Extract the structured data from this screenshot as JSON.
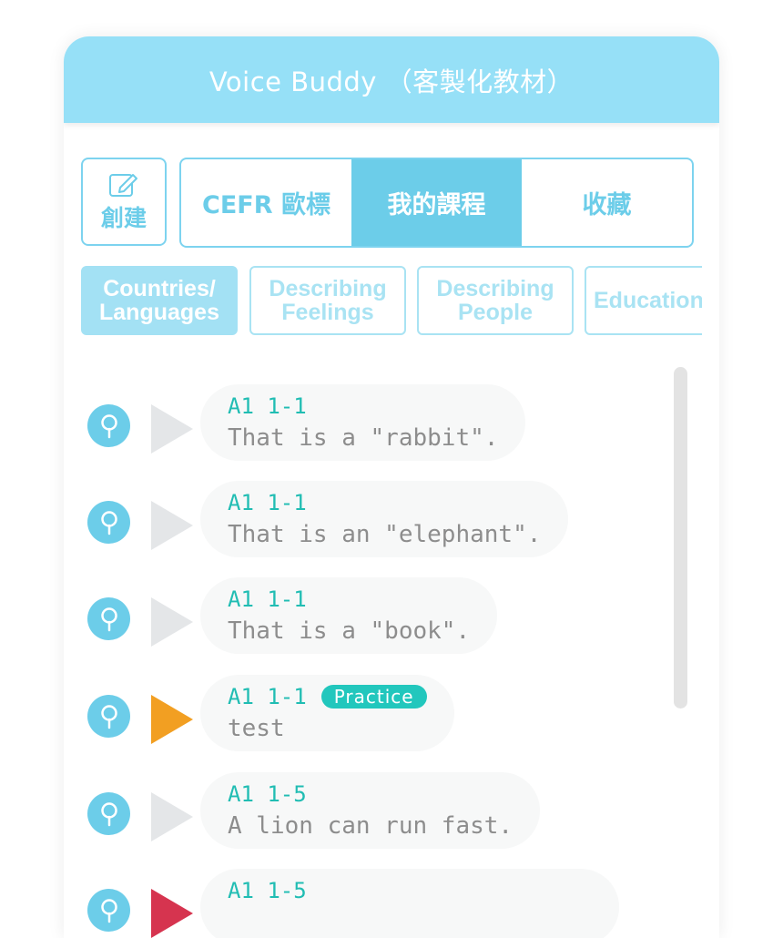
{
  "header": {
    "title": "Voice Buddy （客製化教材）"
  },
  "toolbar": {
    "create_label": "創建",
    "tabs": [
      {
        "label": "CEFR 歐標",
        "active": false
      },
      {
        "label": "我的課程",
        "active": true
      },
      {
        "label": "收藏",
        "active": false
      }
    ]
  },
  "categories": [
    {
      "label": "Countries/ Languages",
      "active": true
    },
    {
      "label": "Describing Feelings",
      "active": false
    },
    {
      "label": "Describing People",
      "active": false
    },
    {
      "label": "Education",
      "active": false
    }
  ],
  "sentences": [
    {
      "level": "A1 1-1",
      "text": "That is a \"rabbit\".",
      "badge": "",
      "play_color": "#e4e6e8"
    },
    {
      "level": "A1 1-1",
      "text": "That is an \"elephant\".",
      "badge": "",
      "play_color": "#e4e6e8"
    },
    {
      "level": "A1 1-1",
      "text": "That is a \"book\".",
      "badge": "",
      "play_color": "#e4e6e8"
    },
    {
      "level": "A1 1-1",
      "text": "test",
      "badge": "Practice",
      "play_color": "#f29f22"
    },
    {
      "level": "A1 1-5",
      "text": "A lion can run fast.",
      "badge": "",
      "play_color": "#e4e6e8"
    },
    {
      "level": "A1 1-5",
      "text": "",
      "badge": "",
      "play_color": "#d6344f"
    }
  ],
  "colors": {
    "header_bg": "#96e0f7",
    "accent": "#6ccde9",
    "level_text": "#21bdb3",
    "practice_badge": "#22c7bd"
  }
}
